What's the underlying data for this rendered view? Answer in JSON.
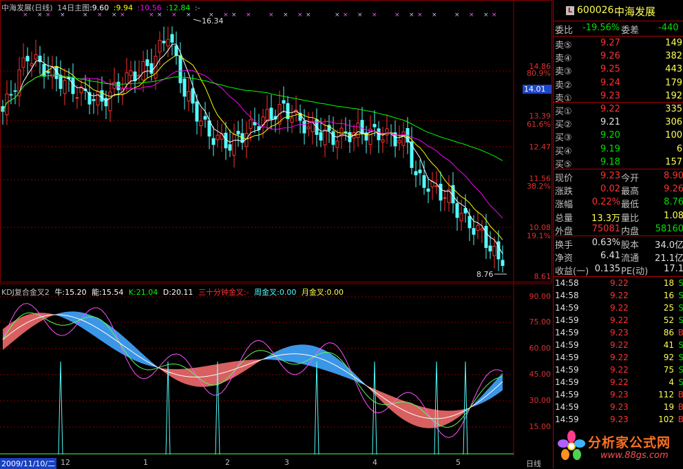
{
  "main_title": {
    "name": "中海发展(日线)",
    "ma_label": "14日主图",
    "v1": ":9.60",
    "v2": ":9.94",
    "v3": ":10.56",
    "v4": ":12.84",
    "v5": ":-"
  },
  "main_annotations": {
    "high": "16.34",
    "low": "8.76"
  },
  "price_axis": [
    {
      "text": "14.86"
    },
    {
      "text": "80.9%"
    },
    {
      "text": "13.39"
    },
    {
      "text": "61.6%"
    },
    {
      "text": "12.47"
    },
    {
      "text": "11.56"
    },
    {
      "text": "38.2%"
    },
    {
      "text": "10.08"
    },
    {
      "text": "19.1%"
    },
    {
      "text": "8.61"
    }
  ],
  "current_price_tag": "14.01",
  "indicator_title": {
    "name": "KDJ复合金叉2",
    "niu": "牛:15.20",
    "neng": "能:15.54",
    "k": "K:21.04",
    "d": "D:20.11",
    "sanshi": "三十分钟金叉:-",
    "zhou": "周金叉:0.00",
    "yue": "月金叉:0.00"
  },
  "indicator_axis": [
    "90.00",
    "75.00",
    "60.00",
    "45.00",
    "30.00",
    "15.00"
  ],
  "date_axis": {
    "first": "2009/11/10/二",
    "labels": [
      "12",
      "1",
      "2",
      "3",
      "4",
      "5"
    ],
    "period": "日线"
  },
  "quote": {
    "code": "600026",
    "name": "中海发展",
    "weibi_label": "委比",
    "weibi": "-19.56%",
    "weicha_label": "委差",
    "weicha": "-440",
    "sells": [
      {
        "label": "卖⑤",
        "price": "9.27",
        "vol": "149"
      },
      {
        "label": "卖④",
        "price": "9.26",
        "vol": "382"
      },
      {
        "label": "卖③",
        "price": "9.25",
        "vol": "443"
      },
      {
        "label": "卖②",
        "price": "9.24",
        "vol": "179"
      },
      {
        "label": "卖①",
        "price": "9.23",
        "vol": "192"
      }
    ],
    "buys": [
      {
        "label": "买①",
        "price": "9.22",
        "vol": "335"
      },
      {
        "label": "买②",
        "price": "9.21",
        "vol": "306"
      },
      {
        "label": "买③",
        "price": "9.20",
        "vol": "100"
      },
      {
        "label": "买④",
        "price": "9.19",
        "vol": "6"
      },
      {
        "label": "买⑤",
        "price": "9.18",
        "vol": "157"
      }
    ],
    "stats": [
      {
        "l1": "现价",
        "v1": "9.23",
        "l2": "今开",
        "v2": "8.90"
      },
      {
        "l1": "涨跌",
        "v1": "0.02",
        "l2": "最高",
        "v2": "9.26"
      },
      {
        "l1": "涨幅",
        "v1": "0.22%",
        "l2": "最低",
        "v2": "8.76"
      },
      {
        "l1": "总量",
        "v1": "13.3万",
        "l2": "量比",
        "v2": "1.08"
      },
      {
        "l1": "外盘",
        "v1": "75081",
        "l2": "内盘",
        "v2": "58160"
      }
    ],
    "stats2": [
      {
        "l1": "换手",
        "v1": "0.63%",
        "l2": "股本",
        "v2": "34.0亿"
      },
      {
        "l1": "净资",
        "v1": "6.41",
        "l2": "流通",
        "v2": "21.1亿"
      },
      {
        "l1": "收益(一)",
        "v1": "0.135",
        "l2": "PE(动)",
        "v2": "17.1"
      }
    ]
  },
  "ticks": [
    {
      "time": "14:58",
      "price": "9.22",
      "vol": "18",
      "side": "S"
    },
    {
      "time": "14:58",
      "price": "9.22",
      "vol": "16",
      "side": "S"
    },
    {
      "time": "14:59",
      "price": "9.22",
      "vol": "25",
      "side": "S"
    },
    {
      "time": "14:59",
      "price": "9.22",
      "vol": "52",
      "side": "S"
    },
    {
      "time": "14:59",
      "price": "9.23",
      "vol": "86",
      "side": "B"
    },
    {
      "time": "14:59",
      "price": "9.22",
      "vol": "41",
      "side": "S"
    },
    {
      "time": "14:59",
      "price": "9.22",
      "vol": "92",
      "side": "S"
    },
    {
      "time": "14:59",
      "price": "9.22",
      "vol": "75",
      "side": "S"
    },
    {
      "time": "14:59",
      "price": "9.22",
      "vol": "4",
      "side": "S"
    },
    {
      "time": "14:59",
      "price": "9.23",
      "vol": "112",
      "side": "B"
    },
    {
      "time": "14:59",
      "price": "9.23",
      "vol": "19",
      "side": "B"
    },
    {
      "time": "14:59",
      "price": "9.23",
      "vol": "102",
      "side": "B"
    }
  ],
  "watermark": {
    "text": "分析家公式网",
    "url": "www.88gs.com"
  },
  "colors": {
    "up": "#ff3232",
    "down": "#54fcfc",
    "ma5": "#ffffff",
    "ma10": "#ffff00",
    "ma20": "#ff00ff",
    "ma60": "#00ff00",
    "grid": "#8b0000",
    "price_red": "#ff3232",
    "price_green": "#00e000",
    "label_yellow": "#ffff54"
  }
}
